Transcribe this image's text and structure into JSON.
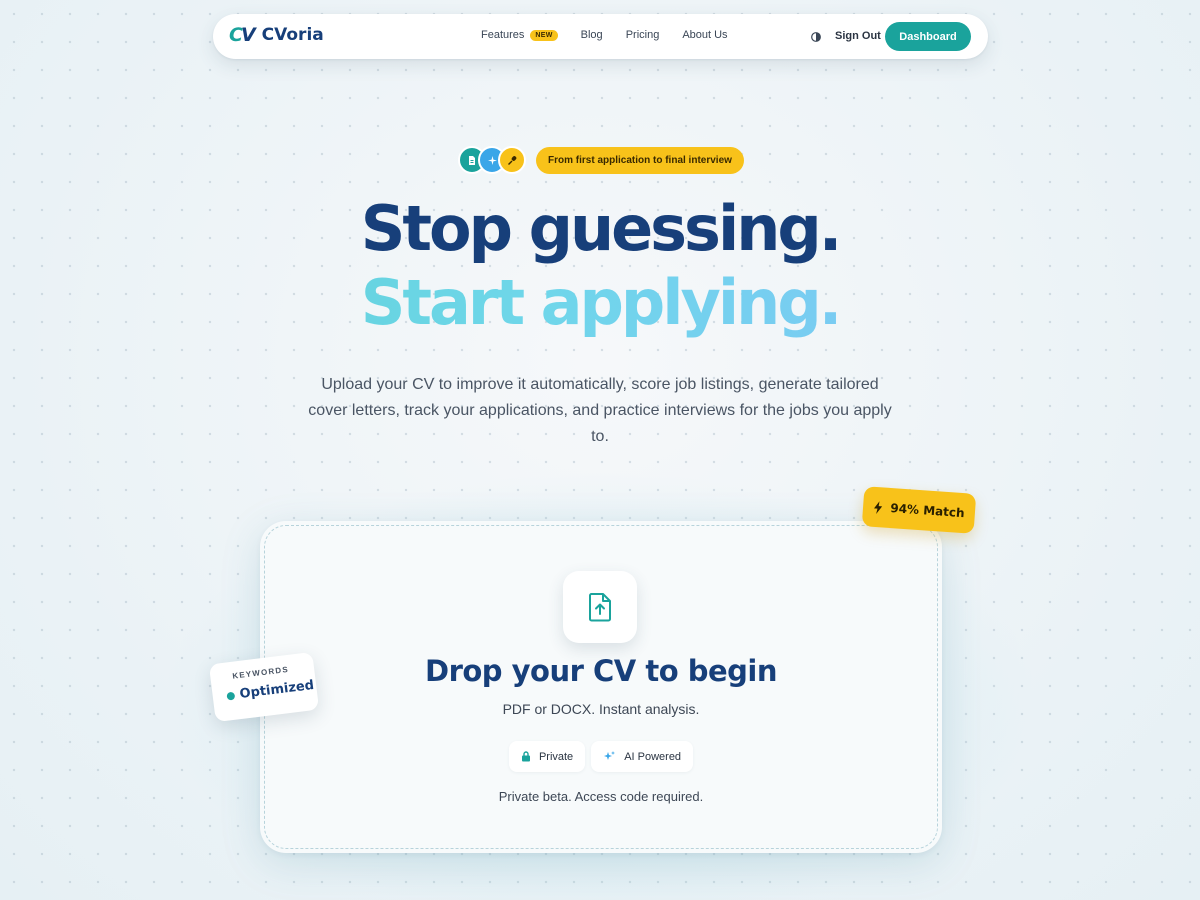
{
  "brand": {
    "mark": "CV",
    "name": "CVoria"
  },
  "nav": {
    "links": [
      {
        "label": "Features",
        "badge": "NEW"
      },
      {
        "label": "Blog"
      },
      {
        "label": "Pricing"
      },
      {
        "label": "About Us"
      }
    ],
    "theme_icon": "theme-toggle-icon",
    "sign_out": "Sign Out",
    "dashboard": "Dashboard"
  },
  "hero": {
    "pill_icons": [
      "document-icon",
      "sparkle-icon",
      "microphone-icon"
    ],
    "pill_text": "From first application to final interview",
    "headline_line1": "Stop guessing.",
    "headline_line2": "Start applying.",
    "subtitle": "Upload your CV to improve it automatically, score job listings, generate tailored cover letters, track your applications, and practice interviews for the jobs you apply to."
  },
  "upload": {
    "icon": "file-upload-icon",
    "title": "Drop your CV to begin",
    "subtitle": "PDF or DOCX. Instant analysis.",
    "chips": [
      {
        "icon": "lock-icon",
        "label": "Private"
      },
      {
        "icon": "sparkle-icon",
        "label": "AI Powered"
      }
    ],
    "note": "Private beta. Access code required."
  },
  "badges": {
    "match": {
      "icon": "lightning-icon",
      "label": "94% Match"
    },
    "keywords": {
      "label": "KEYWORDS",
      "value": "Optimized"
    }
  },
  "colors": {
    "accent_teal": "#1aa39c",
    "navy": "#173f7a",
    "yellow": "#f8c21a",
    "gradient_cyan": "#6fd6ea"
  }
}
